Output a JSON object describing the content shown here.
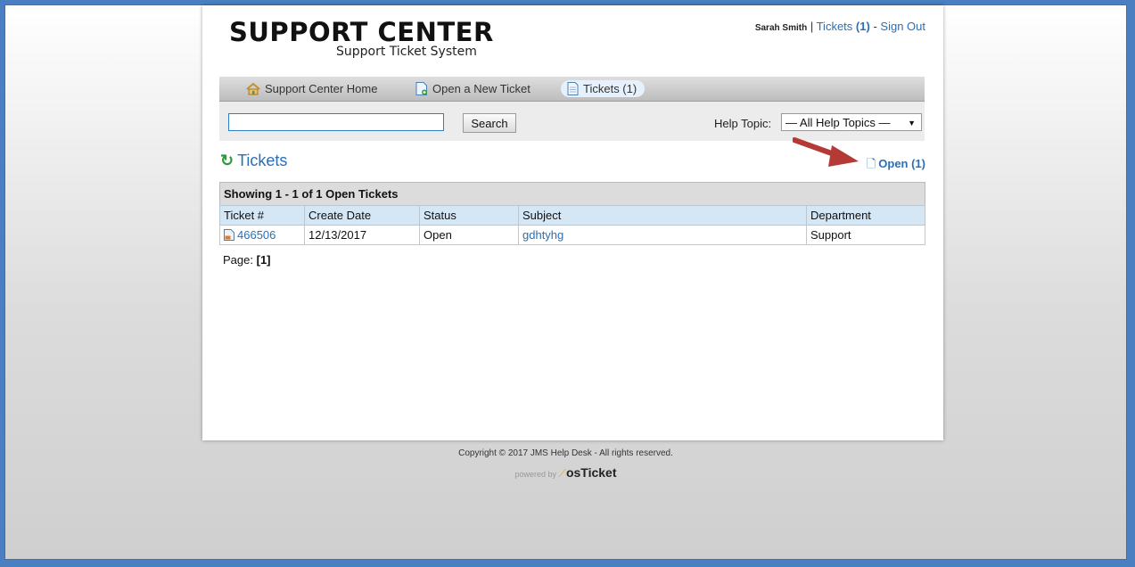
{
  "header": {
    "logo_title": "SUPPORT CENTER",
    "logo_subtitle": "Support Ticket System",
    "user_name": "Sarah Smith",
    "separator": "|",
    "tickets_link_text": "Tickets",
    "tickets_link_count": "(1)",
    "dash": "-",
    "sign_out": "Sign Out"
  },
  "nav": {
    "items": [
      {
        "label": "Support Center Home",
        "icon": "home-icon"
      },
      {
        "label": "Open a New Ticket",
        "icon": "new-ticket-icon"
      },
      {
        "label": "Tickets (1)",
        "icon": "ticket-doc-icon",
        "active": true
      }
    ]
  },
  "search": {
    "value": "",
    "button_label": "Search",
    "help_topic_label": "Help Topic:",
    "help_topic_selected": "— All Help Topics —"
  },
  "tickets": {
    "title": "Tickets",
    "open_filter": "Open (1)",
    "caption": "Showing 1 - 1 of 1 Open Tickets",
    "columns": [
      "Ticket #",
      "Create Date",
      "Status",
      "Subject",
      "Department"
    ],
    "rows": [
      {
        "number": "466506",
        "date": "12/13/2017",
        "status": "Open",
        "subject": "gdhtyhg",
        "department": "Support"
      }
    ],
    "page_label": "Page:",
    "page_current": "[1]"
  },
  "footer": {
    "copyright": "Copyright © 2017 JMS Help Desk - All rights reserved.",
    "powered_by": "powered by",
    "brand": "osTicket"
  },
  "colors": {
    "link": "#2b6fb6",
    "frame": "#4a7fc1",
    "refresh": "#2e9a3a",
    "arrow": "#b43a36"
  }
}
